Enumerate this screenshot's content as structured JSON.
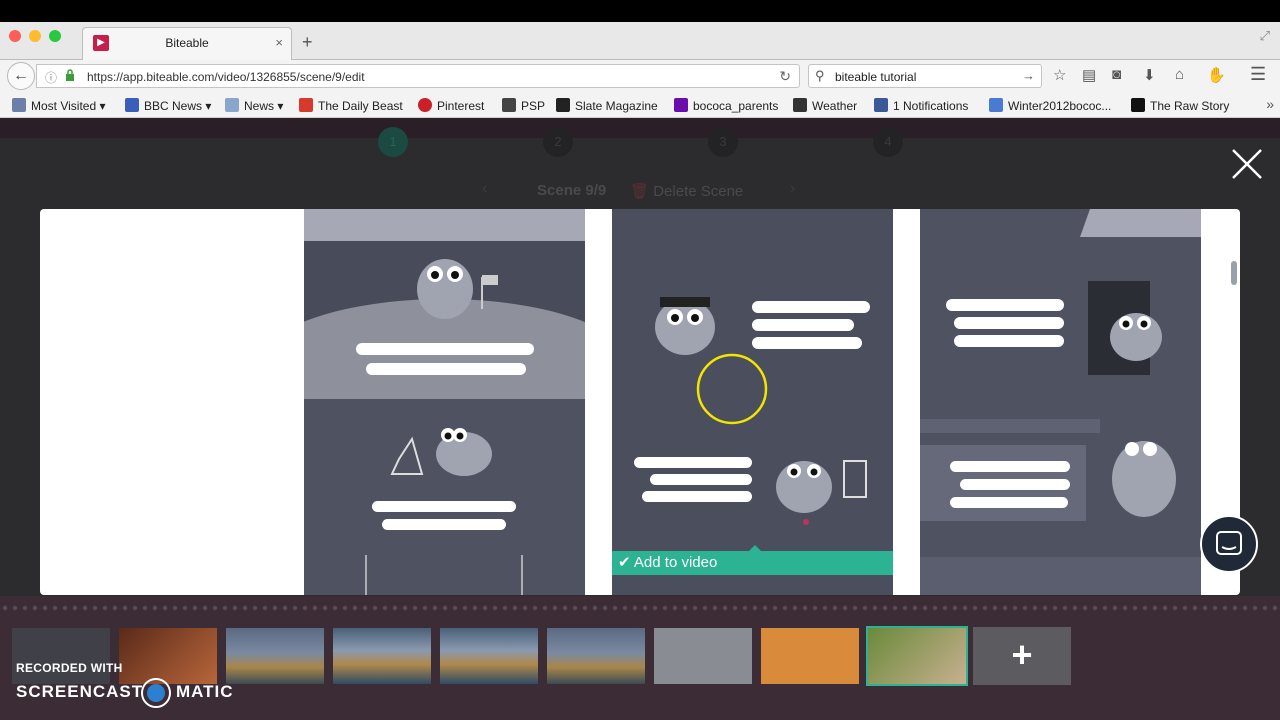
{
  "browser": {
    "tab_title": "Biteable",
    "tab_close": "×",
    "new_tab": "+",
    "url": "https://app.biteable.com/video/1326855/scene/9/edit",
    "search_value": "biteable tutorial"
  },
  "bookmarks": [
    {
      "label": "Most Visited",
      "icon": "star-folder-icon",
      "color": "#6b7fa8"
    },
    {
      "label": "BBC News",
      "icon": "rss-icon",
      "color": "#3a5fb8"
    },
    {
      "label": "News",
      "icon": "folder-icon",
      "color": "#8aa6cc"
    },
    {
      "label": "The Daily Beast",
      "icon": "daily-beast-icon",
      "color": "#d63a2a"
    },
    {
      "label": "Pinterest",
      "icon": "pinterest-icon",
      "color": "#cb2027"
    },
    {
      "label": "PSP",
      "icon": "psp-icon",
      "color": "#444444"
    },
    {
      "label": "Slate Magazine",
      "icon": "slate-icon",
      "color": "#222222"
    },
    {
      "label": "bococa_parents",
      "icon": "yahoo-icon",
      "color": "#6a0dad"
    },
    {
      "label": "Weather",
      "icon": "weather-icon",
      "color": "#333333"
    },
    {
      "label": "1 Notifications",
      "icon": "facebook-icon",
      "color": "#3b5998"
    },
    {
      "label": "Winter2012bococ...",
      "icon": "doc-icon",
      "color": "#4a7bd0"
    },
    {
      "label": "The Raw Story",
      "icon": "rawstory-icon",
      "color": "#111111"
    }
  ],
  "editor": {
    "steps": [
      "1",
      "2",
      "3",
      "4"
    ],
    "scene_label": "Scene 9/9",
    "delete_label": "Delete Scene",
    "add_to_video": "Add to video"
  },
  "watermark": {
    "line1": "RECORDED WITH",
    "brand_left": "SCREENCAST",
    "brand_right": "MATIC"
  },
  "colors": {
    "accent": "#2bb394",
    "scene_bg": "#4e5261",
    "app_bg": "#2c2c2e"
  }
}
